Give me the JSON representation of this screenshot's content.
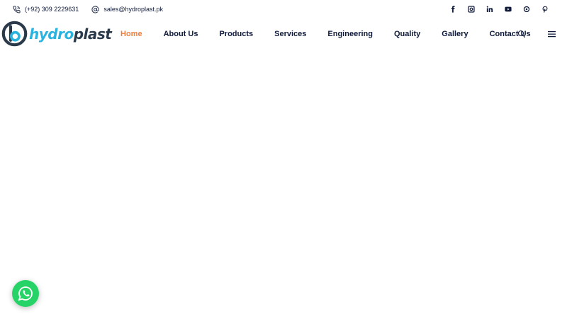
{
  "topbar": {
    "phone": "(+92) 309 2229631",
    "email": "sales@hydroplast.pk",
    "social": [
      {
        "name": "facebook-icon"
      },
      {
        "name": "instagram-icon"
      },
      {
        "name": "linkedin-icon"
      },
      {
        "name": "youtube-icon"
      },
      {
        "name": "aperture-icon"
      },
      {
        "name": "pinterest-icon"
      }
    ]
  },
  "logo": {
    "text_part1": "hydro",
    "text_part2": "plast"
  },
  "nav": {
    "items": [
      {
        "label": "Home",
        "active": true
      },
      {
        "label": "About Us",
        "active": false
      },
      {
        "label": "Products",
        "active": false
      },
      {
        "label": "Services",
        "active": false
      },
      {
        "label": "Engineering",
        "active": false
      },
      {
        "label": "Quality",
        "active": false
      },
      {
        "label": "Gallery",
        "active": false
      },
      {
        "label": "Contact Us",
        "active": false
      }
    ]
  },
  "colors": {
    "accent": "#f07f3c",
    "text": "#0f1a3a",
    "logo_blue": "#2bb3e0",
    "logo_dark": "#2b3a4a",
    "whatsapp": "#25d366"
  }
}
